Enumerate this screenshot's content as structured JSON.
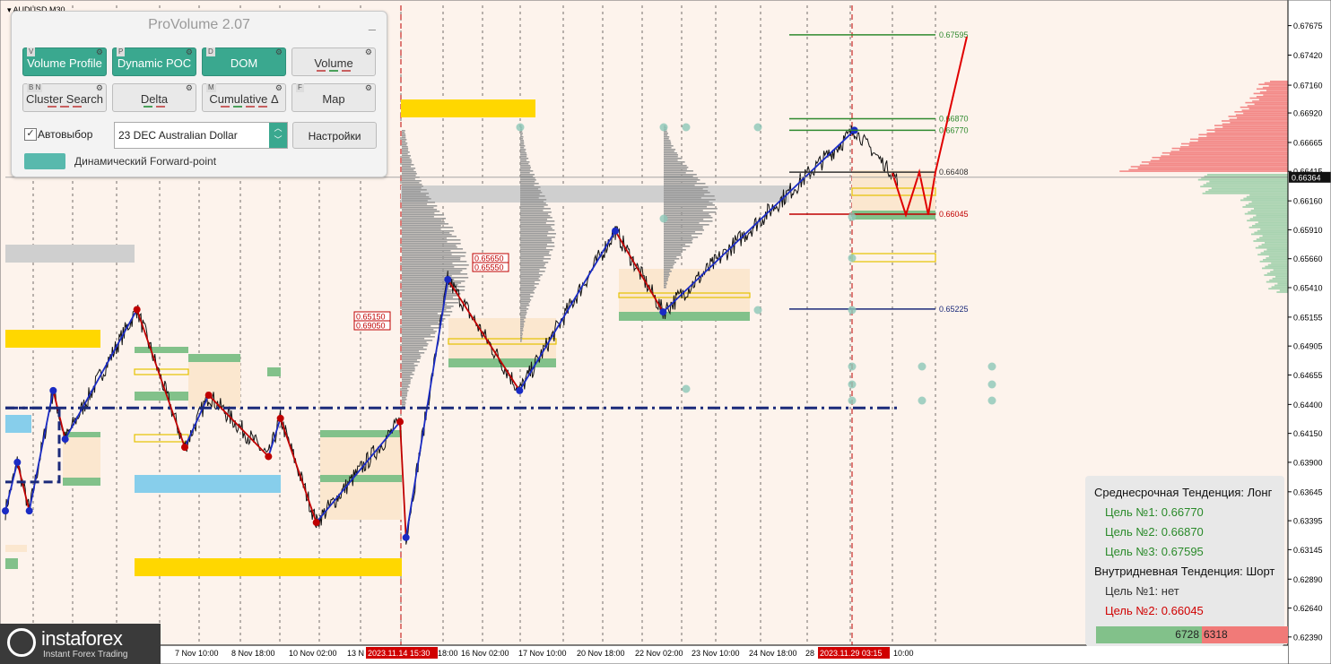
{
  "symbol": "AUDUSD,M30",
  "panel": {
    "title": "ProVolume 2.07",
    "buttons": [
      {
        "key": "V",
        "label": "Volume Profile",
        "active": true
      },
      {
        "key": "P",
        "label": "Dynamic POC",
        "active": true
      },
      {
        "key": "D",
        "label": "DOM",
        "active": true
      },
      {
        "key": "",
        "label": "Volume",
        "active": false
      },
      {
        "key": "B N",
        "label": "Cluster Search",
        "active": false
      },
      {
        "key": "",
        "label": "Delta",
        "active": false
      },
      {
        "key": "M",
        "label": "Cumulative Δ",
        "active": false
      },
      {
        "key": "F",
        "label": "Map",
        "active": false
      }
    ],
    "autoselect_label": "Автовыбор",
    "instrument": "23 DEC Australian Dollar",
    "settings_label": "Настройки",
    "forward_label": "Динамический Forward-point"
  },
  "chart_data": {
    "type": "line",
    "symbol": "AUDUSD,M30",
    "ylim": [
      0.6235,
      0.6785
    ],
    "y_ticks": [
      "0.67675",
      "0.67420",
      "0.67160",
      "0.66920",
      "0.66665",
      "0.66415",
      "0.66160",
      "0.65910",
      "0.65660",
      "0.65410",
      "0.65155",
      "0.64905",
      "0.64655",
      "0.64400",
      "0.64150",
      "0.63900",
      "0.63645",
      "0.63395",
      "0.63145",
      "0.62890",
      "0.62640",
      "0.62390"
    ],
    "current_price": "0.66364",
    "x_labels": [
      "7 Nov 10:00",
      "8 Nov 18:00",
      "10 Nov 02:00",
      "13 N",
      "2023.11.14 15:30",
      "18:00",
      "16 Nov 02:00",
      "17 Nov 10:00",
      "20 Nov 18:00",
      "22 Nov 02:00",
      "23 Nov 10:00",
      "24 Nov 18:00",
      "28",
      "2023.11.29 03:15",
      "10:00"
    ],
    "zigzag_points": [
      {
        "t": 0,
        "price": 0.6348,
        "color": "blue"
      },
      {
        "t": 1,
        "price": 0.639,
        "color": "blue"
      },
      {
        "t": 2,
        "price": 0.6348,
        "color": "blue"
      },
      {
        "t": 4,
        "price": 0.6452,
        "color": "blue"
      },
      {
        "t": 5,
        "price": 0.641,
        "color": "blue"
      },
      {
        "t": 11,
        "price": 0.6522,
        "color": "red"
      },
      {
        "t": 15,
        "price": 0.6403,
        "color": "red"
      },
      {
        "t": 17,
        "price": 0.6448,
        "color": "red"
      },
      {
        "t": 22,
        "price": 0.6395,
        "color": "red"
      },
      {
        "t": 23,
        "price": 0.6428,
        "color": "red"
      },
      {
        "t": 26,
        "price": 0.6338,
        "color": "red"
      },
      {
        "t": 33,
        "price": 0.6425,
        "color": "red"
      },
      {
        "t": 33.5,
        "price": 0.6325,
        "color": "blue"
      },
      {
        "t": 37,
        "price": 0.6548,
        "color": "blue"
      },
      {
        "t": 43,
        "price": 0.6452,
        "color": "blue"
      },
      {
        "t": 51,
        "price": 0.659,
        "color": "blue"
      },
      {
        "t": 55,
        "price": 0.652,
        "color": "blue"
      },
      {
        "t": 71,
        "price": 0.6677,
        "color": "blue"
      }
    ],
    "forecast": [
      0.664,
      0.6604,
      0.6641,
      0.6604,
      0.6641,
      0.6758
    ],
    "levels": [
      {
        "label": "0.67595",
        "price": 0.67595,
        "color": "#2f8a2f"
      },
      {
        "label": "0.66870",
        "price": 0.6687,
        "color": "#2f8a2f"
      },
      {
        "label": "0.66770",
        "price": 0.6677,
        "color": "#2f8a2f"
      },
      {
        "label": "0.66408",
        "price": 0.66408,
        "color": "#333333"
      },
      {
        "label": "0.66045",
        "price": 0.66045,
        "color": "#c00000"
      },
      {
        "label": "0.65225",
        "price": 0.65225,
        "color": "#1b2a7a"
      }
    ],
    "price_boxes": [
      "0.65650",
      "0.65550",
      "0.65150",
      "0.69050"
    ],
    "dom_volumes": [
      "6728",
      "6318"
    ],
    "colors": {
      "buy": "#82c18a",
      "sell": "#f17a78",
      "zigzag_up": "#1a2bc4",
      "zigzag_down": "#c00000",
      "level_gold": "#ffd700",
      "level_blue": "#87ceeb",
      "grid": "#000000",
      "profile": "#9a9a9a"
    }
  },
  "trend": {
    "mid_title": "Среднесрочная Тенденция: Лонг",
    "mid_targets": [
      "Цель №1: 0.66770",
      "Цель №2: 0.66870",
      "Цель №3: 0.67595"
    ],
    "intra_title": "Внутридневная Тенденция: Шорт",
    "intra_targets": [
      "Цель №1: нет",
      "Цель №2: 0.66045"
    ]
  },
  "brand": {
    "name": "instaforex",
    "tagline": "Instant Forex Trading"
  }
}
